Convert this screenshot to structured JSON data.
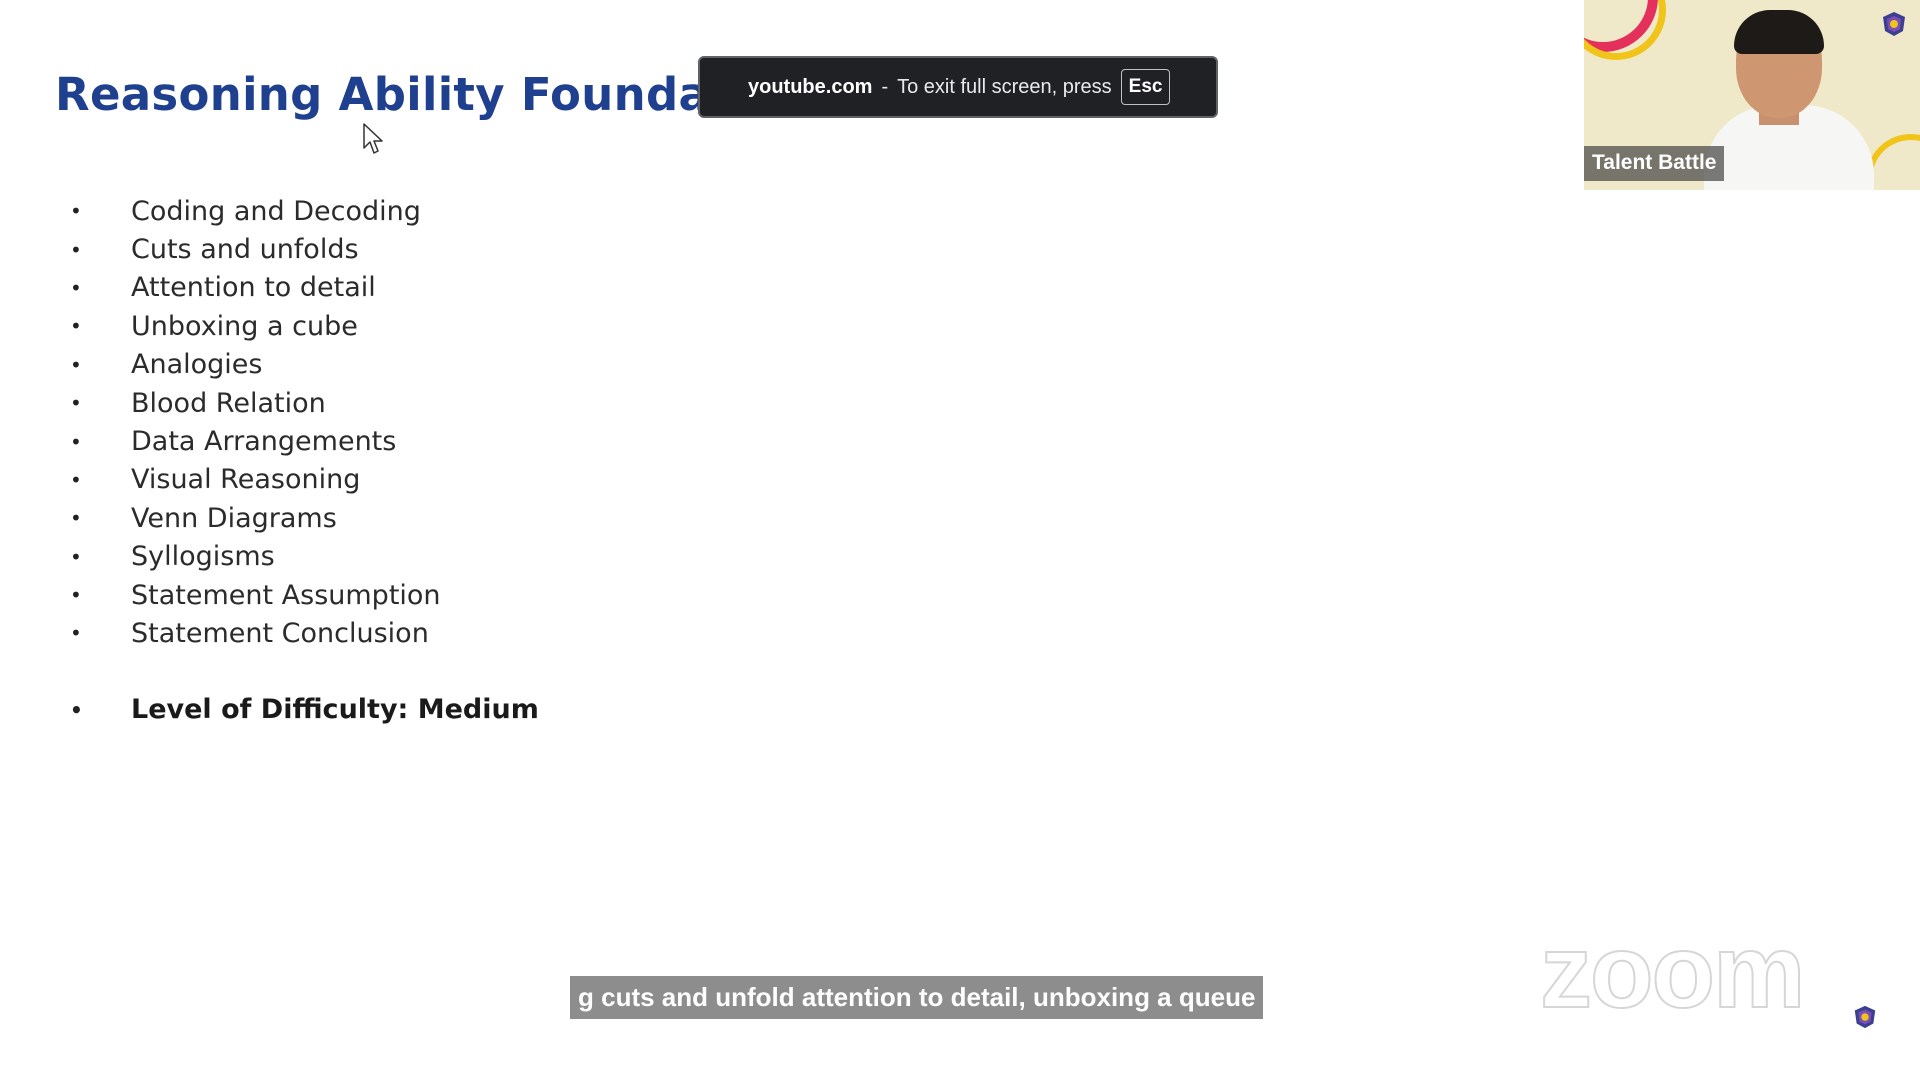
{
  "slide": {
    "title": "Reasoning Ability Foundation",
    "topics": [
      "Coding and Decoding",
      "Cuts and unfolds",
      "Attention to detail",
      "Unboxing a cube",
      "Analogies",
      "Blood Relation",
      "Data Arrangements",
      "Visual Reasoning",
      "Venn Diagrams",
      "Syllogisms",
      "Statement Assumption",
      "Statement Conclusion"
    ],
    "difficulty": "Level of Difficulty: Medium",
    "bullet_glyph": "•",
    "title_color": "#1f3f8f"
  },
  "fullscreen_notice": {
    "domain": "youtube.com",
    "separator": "-",
    "message": "To exit full screen, press",
    "key": "Esc"
  },
  "presenter": {
    "name": "Talent Battle"
  },
  "captions": {
    "text": "g cuts and unfold attention to detail, unboxing a queue"
  },
  "watermark": {
    "text": "zoom"
  },
  "icons": {
    "cursor": "mouse-pointer-icon",
    "logo": "talent-battle-logo-icon"
  }
}
